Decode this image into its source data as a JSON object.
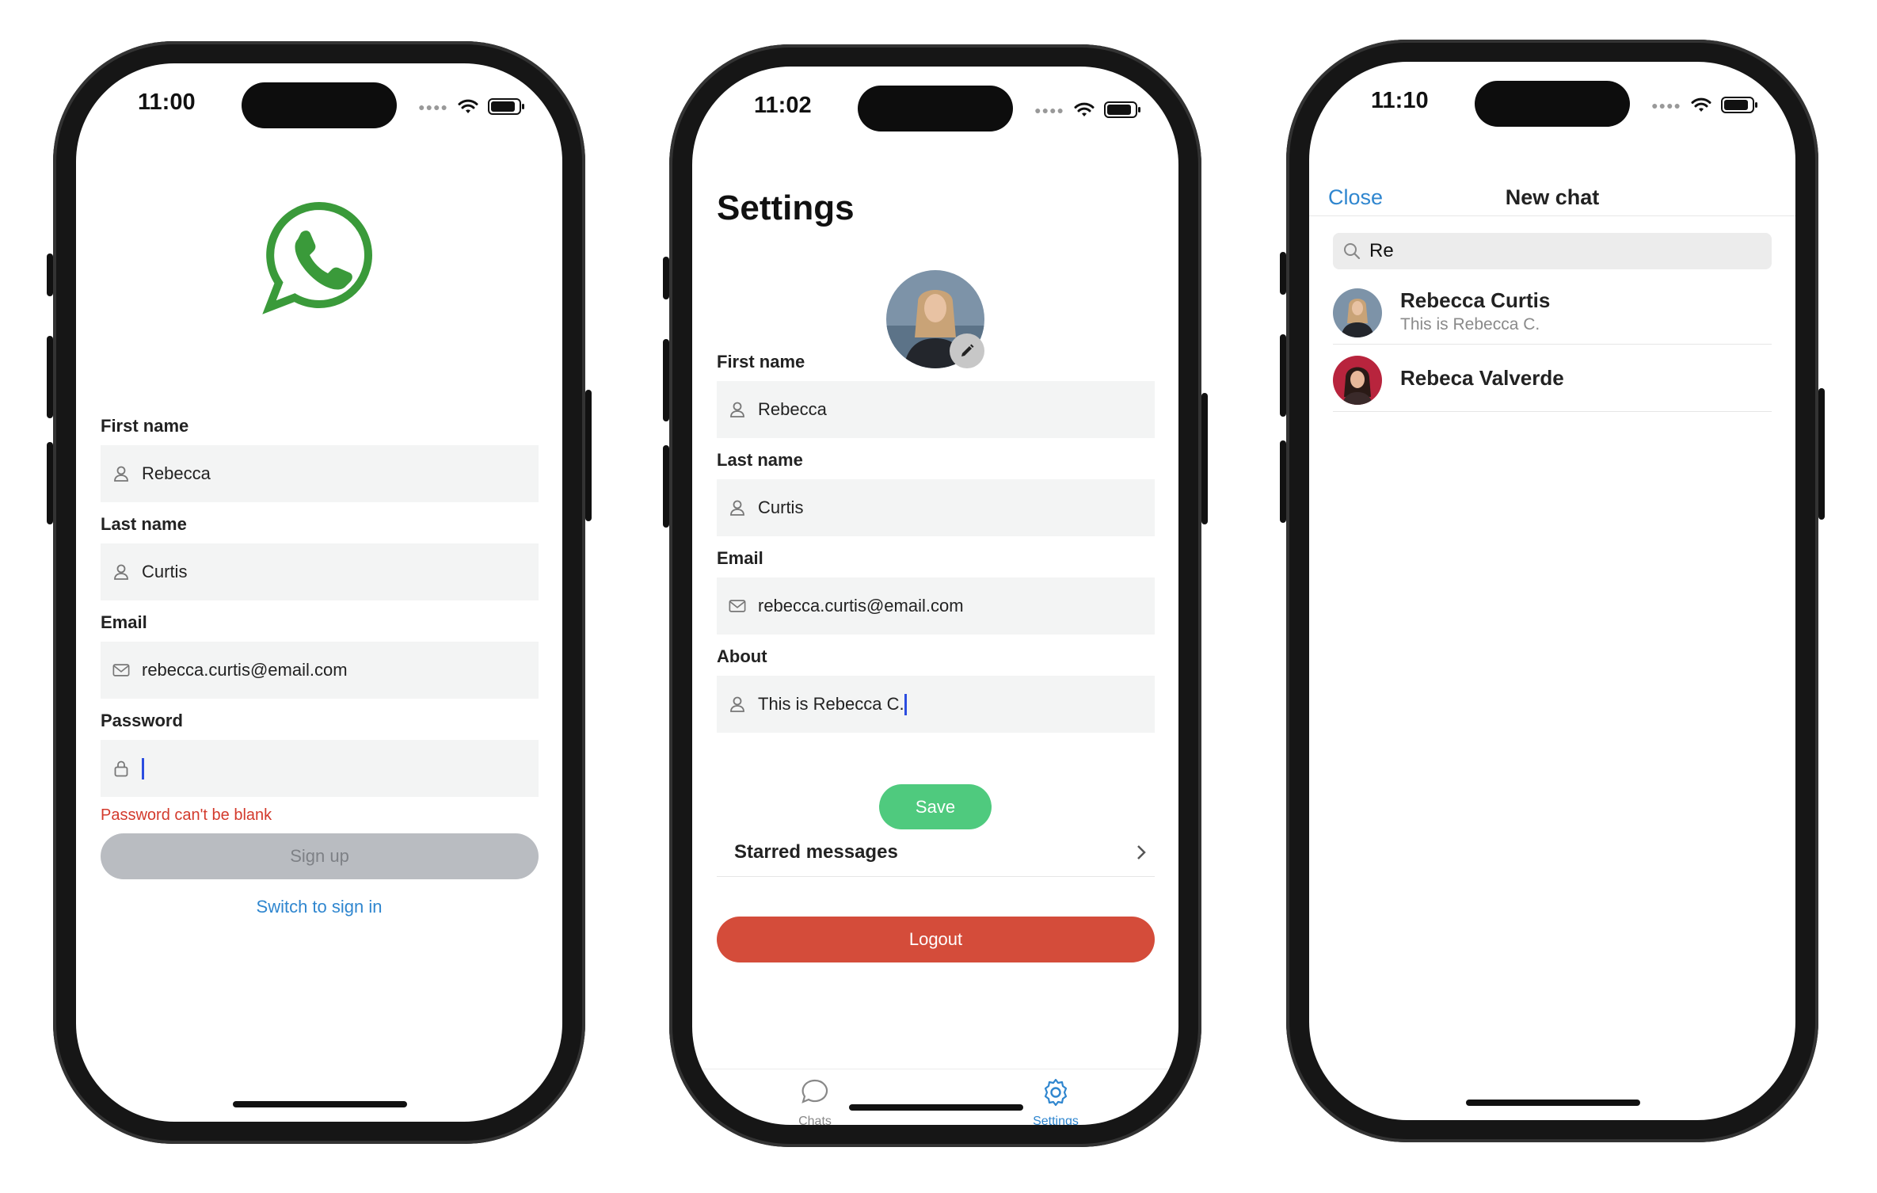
{
  "phone1": {
    "time": "11:00",
    "logo": "whatsapp-logo",
    "fields": [
      {
        "label": "First name",
        "value": "Rebecca",
        "icon": "user-icon"
      },
      {
        "label": "Last name",
        "value": "Curtis",
        "icon": "user-icon"
      },
      {
        "label": "Email",
        "value": "rebecca.curtis@email.com",
        "icon": "mail-icon"
      },
      {
        "label": "Password",
        "value": "",
        "icon": "lock-icon"
      }
    ],
    "error": "Password can't be blank",
    "signup_label": "Sign up",
    "switch_label": "Switch to sign in"
  },
  "phone2": {
    "time": "11:02",
    "title": "Settings",
    "fields": [
      {
        "label": "First name",
        "value": "Rebecca",
        "icon": "user-icon"
      },
      {
        "label": "Last name",
        "value": "Curtis",
        "icon": "user-icon"
      },
      {
        "label": "Email",
        "value": "rebecca.curtis@email.com",
        "icon": "mail-icon"
      },
      {
        "label": "About",
        "value": "This is Rebecca C.",
        "icon": "user-icon"
      }
    ],
    "save_label": "Save",
    "starred_label": "Starred messages",
    "logout_label": "Logout",
    "tabs": [
      {
        "label": "Chats",
        "icon": "chat-bubble-icon",
        "active": false
      },
      {
        "label": "Settings",
        "icon": "gear-icon",
        "active": true
      }
    ]
  },
  "phone3": {
    "time": "11:10",
    "close_label": "Close",
    "nav_title": "New chat",
    "search_value": "Re",
    "contacts": [
      {
        "name": "Rebecca Curtis",
        "about": "This is Rebecca C."
      },
      {
        "name": "Rebeca Valverde",
        "about": ""
      }
    ]
  },
  "colors": {
    "link_blue": "#2f86cf",
    "save_green": "#4fca7e",
    "logout_red": "#d44c3a",
    "error_red": "#d33a2c",
    "field_bg": "#f3f4f4",
    "whatsapp_green": "#3a9a3a"
  }
}
